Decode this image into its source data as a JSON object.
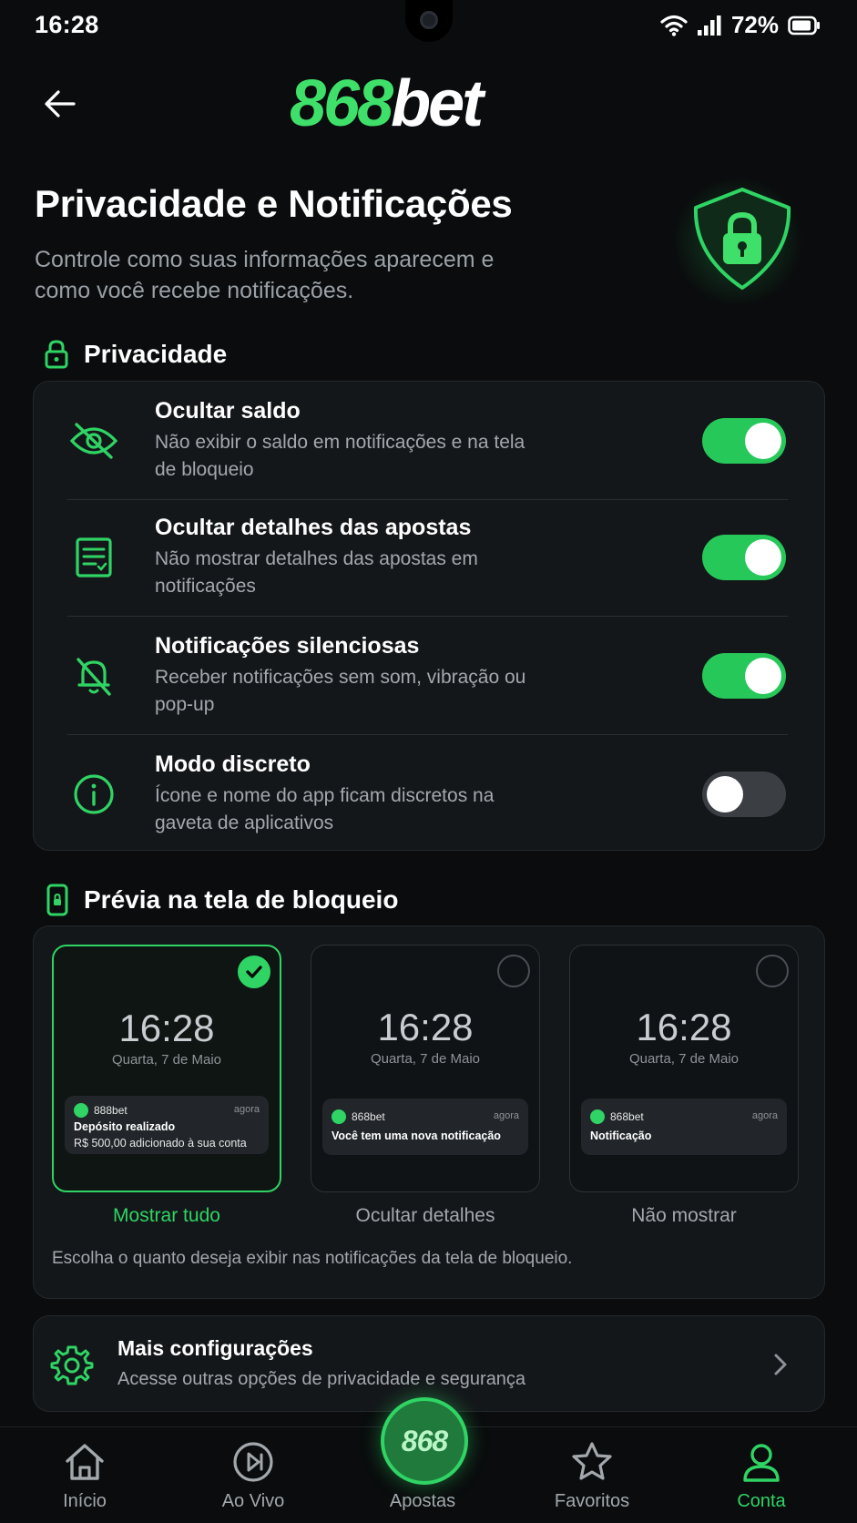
{
  "status_bar": {
    "time": "16:28",
    "battery": "72%"
  },
  "header": {
    "logo_number": "868",
    "logo_text": "bet"
  },
  "page": {
    "title": "Privacidade e Notificações",
    "subtitle": "Controle como suas informações aparecem e como você recebe notificações."
  },
  "privacy": {
    "heading": "Privacidade",
    "items": [
      {
        "title": "Ocultar saldo",
        "desc": "Não exibir o saldo em notificações e na tela de bloqueio",
        "enabled": true,
        "icon": "eye-off-icon"
      },
      {
        "title": "Ocultar detalhes das apostas",
        "desc": "Não mostrar detalhes das apostas em notificações",
        "enabled": true,
        "icon": "document-icon"
      },
      {
        "title": "Notificações silenciosas",
        "desc": "Receber notificações sem som, vibração ou pop-up",
        "enabled": true,
        "icon": "bell-off-icon"
      },
      {
        "title": "Modo discreto",
        "desc": "Ícone e nome do app ficam discretos na gaveta de aplicativos",
        "enabled": false,
        "icon": "info-icon"
      }
    ]
  },
  "lock_preview": {
    "heading": "Prévia na tela de bloqueio",
    "options": [
      {
        "label": "Mostrar tudo",
        "selected": true,
        "time": "16:28",
        "date": "Quarta, 7 de Maio",
        "app": "888bet",
        "when": "agora",
        "line1": "Depósito realizado",
        "line2": "R$ 500,00 adicionado à sua conta"
      },
      {
        "label": "Ocultar detalhes",
        "selected": false,
        "time": "16:28",
        "date": "Quarta, 7 de Maio",
        "app": "868bet",
        "when": "agora",
        "line1": "Você tem uma nova notificação"
      },
      {
        "label": "Não mostrar",
        "selected": false,
        "time": "16:28",
        "date": "Quarta, 7 de Maio",
        "app": "868bet",
        "when": "agora",
        "line1": "Notificação"
      }
    ],
    "hint": "Escolha o quanto deseja exibir nas notificações da tela de bloqueio."
  },
  "more_settings": {
    "title": "Mais configurações",
    "desc": "Acesse outras opções de privacidade e segurança"
  },
  "nav": {
    "items": [
      {
        "label": "Início",
        "icon": "home-icon"
      },
      {
        "label": "Ao Vivo",
        "icon": "live-play-icon"
      },
      {
        "label": "Apostas",
        "icon": "bets-logo-icon",
        "center_text": "868"
      },
      {
        "label": "Favoritos",
        "icon": "star-icon"
      },
      {
        "label": "Conta",
        "icon": "user-icon",
        "active": true
      }
    ]
  },
  "colors": {
    "accent": "#2fd464",
    "background": "#0a0c0d",
    "card": "#14171a",
    "muted": "#a3a8ad"
  }
}
